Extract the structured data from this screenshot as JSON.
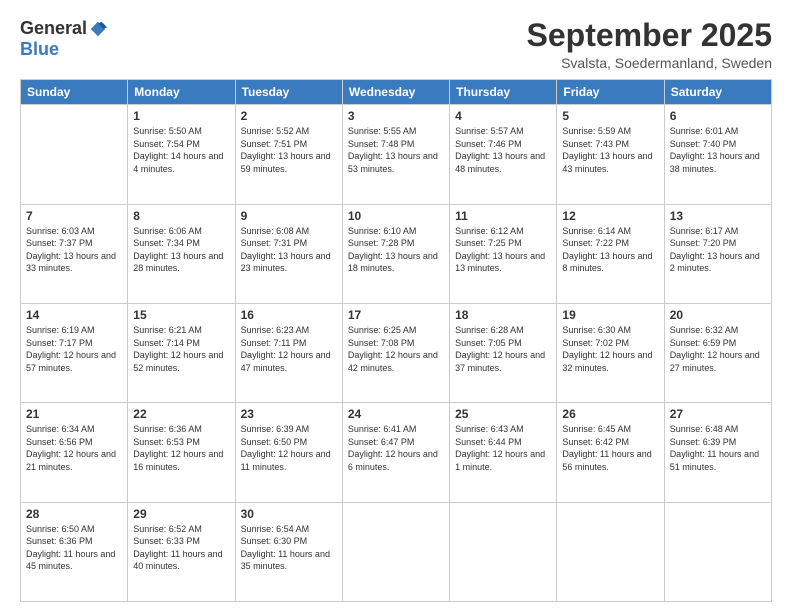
{
  "logo": {
    "general": "General",
    "blue": "Blue"
  },
  "title": "September 2025",
  "location": "Svalsta, Soedermanland, Sweden",
  "days_of_week": [
    "Sunday",
    "Monday",
    "Tuesday",
    "Wednesday",
    "Thursday",
    "Friday",
    "Saturday"
  ],
  "weeks": [
    [
      {
        "day": "",
        "sunrise": "",
        "sunset": "",
        "daylight": ""
      },
      {
        "day": "1",
        "sunrise": "Sunrise: 5:50 AM",
        "sunset": "Sunset: 7:54 PM",
        "daylight": "Daylight: 14 hours and 4 minutes."
      },
      {
        "day": "2",
        "sunrise": "Sunrise: 5:52 AM",
        "sunset": "Sunset: 7:51 PM",
        "daylight": "Daylight: 13 hours and 59 minutes."
      },
      {
        "day": "3",
        "sunrise": "Sunrise: 5:55 AM",
        "sunset": "Sunset: 7:48 PM",
        "daylight": "Daylight: 13 hours and 53 minutes."
      },
      {
        "day": "4",
        "sunrise": "Sunrise: 5:57 AM",
        "sunset": "Sunset: 7:46 PM",
        "daylight": "Daylight: 13 hours and 48 minutes."
      },
      {
        "day": "5",
        "sunrise": "Sunrise: 5:59 AM",
        "sunset": "Sunset: 7:43 PM",
        "daylight": "Daylight: 13 hours and 43 minutes."
      },
      {
        "day": "6",
        "sunrise": "Sunrise: 6:01 AM",
        "sunset": "Sunset: 7:40 PM",
        "daylight": "Daylight: 13 hours and 38 minutes."
      }
    ],
    [
      {
        "day": "7",
        "sunrise": "Sunrise: 6:03 AM",
        "sunset": "Sunset: 7:37 PM",
        "daylight": "Daylight: 13 hours and 33 minutes."
      },
      {
        "day": "8",
        "sunrise": "Sunrise: 6:06 AM",
        "sunset": "Sunset: 7:34 PM",
        "daylight": "Daylight: 13 hours and 28 minutes."
      },
      {
        "day": "9",
        "sunrise": "Sunrise: 6:08 AM",
        "sunset": "Sunset: 7:31 PM",
        "daylight": "Daylight: 13 hours and 23 minutes."
      },
      {
        "day": "10",
        "sunrise": "Sunrise: 6:10 AM",
        "sunset": "Sunset: 7:28 PM",
        "daylight": "Daylight: 13 hours and 18 minutes."
      },
      {
        "day": "11",
        "sunrise": "Sunrise: 6:12 AM",
        "sunset": "Sunset: 7:25 PM",
        "daylight": "Daylight: 13 hours and 13 minutes."
      },
      {
        "day": "12",
        "sunrise": "Sunrise: 6:14 AM",
        "sunset": "Sunset: 7:22 PM",
        "daylight": "Daylight: 13 hours and 8 minutes."
      },
      {
        "day": "13",
        "sunrise": "Sunrise: 6:17 AM",
        "sunset": "Sunset: 7:20 PM",
        "daylight": "Daylight: 13 hours and 2 minutes."
      }
    ],
    [
      {
        "day": "14",
        "sunrise": "Sunrise: 6:19 AM",
        "sunset": "Sunset: 7:17 PM",
        "daylight": "Daylight: 12 hours and 57 minutes."
      },
      {
        "day": "15",
        "sunrise": "Sunrise: 6:21 AM",
        "sunset": "Sunset: 7:14 PM",
        "daylight": "Daylight: 12 hours and 52 minutes."
      },
      {
        "day": "16",
        "sunrise": "Sunrise: 6:23 AM",
        "sunset": "Sunset: 7:11 PM",
        "daylight": "Daylight: 12 hours and 47 minutes."
      },
      {
        "day": "17",
        "sunrise": "Sunrise: 6:25 AM",
        "sunset": "Sunset: 7:08 PM",
        "daylight": "Daylight: 12 hours and 42 minutes."
      },
      {
        "day": "18",
        "sunrise": "Sunrise: 6:28 AM",
        "sunset": "Sunset: 7:05 PM",
        "daylight": "Daylight: 12 hours and 37 minutes."
      },
      {
        "day": "19",
        "sunrise": "Sunrise: 6:30 AM",
        "sunset": "Sunset: 7:02 PM",
        "daylight": "Daylight: 12 hours and 32 minutes."
      },
      {
        "day": "20",
        "sunrise": "Sunrise: 6:32 AM",
        "sunset": "Sunset: 6:59 PM",
        "daylight": "Daylight: 12 hours and 27 minutes."
      }
    ],
    [
      {
        "day": "21",
        "sunrise": "Sunrise: 6:34 AM",
        "sunset": "Sunset: 6:56 PM",
        "daylight": "Daylight: 12 hours and 21 minutes."
      },
      {
        "day": "22",
        "sunrise": "Sunrise: 6:36 AM",
        "sunset": "Sunset: 6:53 PM",
        "daylight": "Daylight: 12 hours and 16 minutes."
      },
      {
        "day": "23",
        "sunrise": "Sunrise: 6:39 AM",
        "sunset": "Sunset: 6:50 PM",
        "daylight": "Daylight: 12 hours and 11 minutes."
      },
      {
        "day": "24",
        "sunrise": "Sunrise: 6:41 AM",
        "sunset": "Sunset: 6:47 PM",
        "daylight": "Daylight: 12 hours and 6 minutes."
      },
      {
        "day": "25",
        "sunrise": "Sunrise: 6:43 AM",
        "sunset": "Sunset: 6:44 PM",
        "daylight": "Daylight: 12 hours and 1 minute."
      },
      {
        "day": "26",
        "sunrise": "Sunrise: 6:45 AM",
        "sunset": "Sunset: 6:42 PM",
        "daylight": "Daylight: 11 hours and 56 minutes."
      },
      {
        "day": "27",
        "sunrise": "Sunrise: 6:48 AM",
        "sunset": "Sunset: 6:39 PM",
        "daylight": "Daylight: 11 hours and 51 minutes."
      }
    ],
    [
      {
        "day": "28",
        "sunrise": "Sunrise: 6:50 AM",
        "sunset": "Sunset: 6:36 PM",
        "daylight": "Daylight: 11 hours and 45 minutes."
      },
      {
        "day": "29",
        "sunrise": "Sunrise: 6:52 AM",
        "sunset": "Sunset: 6:33 PM",
        "daylight": "Daylight: 11 hours and 40 minutes."
      },
      {
        "day": "30",
        "sunrise": "Sunrise: 6:54 AM",
        "sunset": "Sunset: 6:30 PM",
        "daylight": "Daylight: 11 hours and 35 minutes."
      },
      {
        "day": "",
        "sunrise": "",
        "sunset": "",
        "daylight": ""
      },
      {
        "day": "",
        "sunrise": "",
        "sunset": "",
        "daylight": ""
      },
      {
        "day": "",
        "sunrise": "",
        "sunset": "",
        "daylight": ""
      },
      {
        "day": "",
        "sunrise": "",
        "sunset": "",
        "daylight": ""
      }
    ]
  ]
}
